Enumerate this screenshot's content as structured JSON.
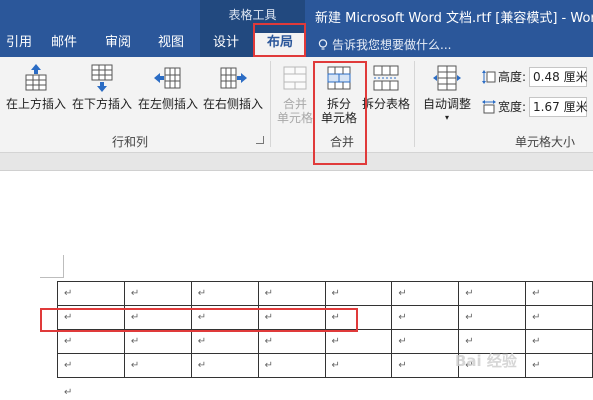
{
  "titlebar": {
    "context_group": "表格工具",
    "document_title": "新建 Microsoft Word 文档.rtf [兼容模式] - Word"
  },
  "tabs": [
    {
      "label": "引用"
    },
    {
      "label": "邮件"
    },
    {
      "label": "审阅"
    },
    {
      "label": "视图"
    },
    {
      "label": "设计"
    },
    {
      "label": "布局"
    }
  ],
  "tellme": {
    "placeholder": "告诉我您想要做什么..."
  },
  "ribbon": {
    "rows_cols": {
      "insert_above": "在上方插入",
      "insert_below": "在下方插入",
      "insert_left": "在左侧插入",
      "insert_right": "在右侧插入",
      "group_label": "行和列"
    },
    "merge": {
      "merge_cells_line1": "合并",
      "merge_cells_line2": "单元格",
      "split_cells_line1": "拆分",
      "split_cells_line2": "单元格",
      "split_table": "拆分表格",
      "group_label": "合并"
    },
    "cell_size": {
      "autofit": "自动调整",
      "height_label": "高度:",
      "height_value": "0.48 厘米",
      "width_label": "宽度:",
      "width_value": "1.67 厘米",
      "group_label": "单元格大小"
    }
  },
  "document": {
    "para_mark": "↵",
    "rows": 4,
    "cols": 8
  },
  "watermark": "Bai 经验"
}
